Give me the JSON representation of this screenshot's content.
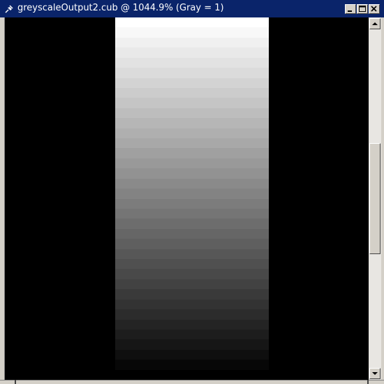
{
  "window": {
    "title": "greyscaleOutput2.cub @ 1044.9% (Gray = 1)",
    "app_icon": "pin-icon",
    "controls": [
      {
        "name": "minimize",
        "icon": "minimize-icon"
      },
      {
        "name": "maximize",
        "icon": "maximize-icon"
      },
      {
        "name": "close",
        "icon": "close-icon"
      }
    ]
  },
  "image": {
    "description_colors": {
      "background": "#000000",
      "gradient_top": "#ffffff",
      "gradient_bottom": "#000000"
    },
    "gradient_steps": 36
  },
  "scrollbar": {
    "vertical_position": 0.5,
    "visible_fraction": 0.33
  }
}
